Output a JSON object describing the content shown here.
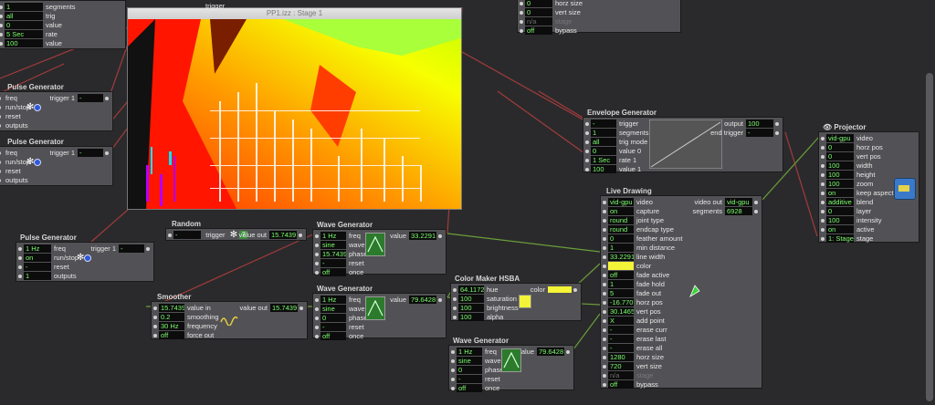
{
  "stage": {
    "title": "PP1.izz : Stage 1"
  },
  "top_left": {
    "rows": [
      {
        "value": "1",
        "label": "segments"
      },
      {
        "value": "all",
        "label": "trig"
      },
      {
        "value": "0",
        "label": "value"
      },
      {
        "value": "5 Sec",
        "label": "rate"
      },
      {
        "value": "100",
        "label": "value"
      }
    ]
  },
  "top_right": {
    "rows": [
      {
        "value": "0",
        "label": "horz size"
      },
      {
        "value": "0",
        "label": "vert size"
      },
      {
        "value": "n/a",
        "label": "stage"
      },
      {
        "value": "off",
        "label": "bypass"
      }
    ],
    "trigger_label": "trigger"
  },
  "gen_a": {
    "title": "Pulse Generator",
    "rows": [
      {
        "label": "freq"
      },
      {
        "label": "run/stop"
      },
      {
        "label": "reset"
      },
      {
        "label": "outputs"
      }
    ],
    "trigger_label": "trigger 1",
    "trigger_val": "-"
  },
  "gen_b": {
    "title": "Pulse Generator",
    "rows": [
      {
        "label": "freq"
      },
      {
        "label": "run/stop"
      },
      {
        "label": "reset"
      },
      {
        "label": "outputs"
      }
    ],
    "trigger_label": "trigger 1",
    "trigger_val": "-"
  },
  "pulse": {
    "title": "Pulse Generator",
    "rows": [
      {
        "value": "1 Hz",
        "label": "freq"
      },
      {
        "value": "on",
        "label": "run/stop"
      },
      {
        "value": "-",
        "label": "reset"
      },
      {
        "value": "1",
        "label": "outputs"
      }
    ],
    "trigger_label": "trigger 1",
    "trigger_val": "-"
  },
  "random": {
    "title": "Random",
    "in_val": "-",
    "trigger_label": "trigger",
    "value_out_label": "value out",
    "value_out": "15.7439"
  },
  "smoother": {
    "title": "Smoother",
    "rows": [
      {
        "value": "15.7439",
        "label": "value in"
      },
      {
        "value": "0.2",
        "label": "smoothing"
      },
      {
        "value": "30 Hz",
        "label": "frequency"
      },
      {
        "value": "off",
        "label": "force out"
      }
    ],
    "out_label": "value out",
    "out_val": "15.7439"
  },
  "wave1": {
    "title": "Wave Generator",
    "rows": [
      {
        "value": "1 Hz",
        "label": "freq"
      },
      {
        "value": "sine",
        "label": "wave"
      },
      {
        "value": "15.7439",
        "label": "phase"
      },
      {
        "value": "-",
        "label": "reset"
      },
      {
        "value": "off",
        "label": "once"
      }
    ],
    "out_label": "value",
    "out_val": "33.2291"
  },
  "wave2": {
    "title": "Wave Generator",
    "rows": [
      {
        "value": "1 Hz",
        "label": "freq"
      },
      {
        "value": "sine",
        "label": "wave"
      },
      {
        "value": "0",
        "label": "phase"
      },
      {
        "value": "-",
        "label": "reset"
      },
      {
        "value": "off",
        "label": "once"
      }
    ],
    "out_label": "value",
    "out_val": "79.6428"
  },
  "wave3": {
    "title": "Wave Generator",
    "rows": [
      {
        "value": "1 Hz",
        "label": "freq"
      },
      {
        "value": "sine",
        "label": "wave"
      },
      {
        "value": "0",
        "label": "phase"
      },
      {
        "value": "-",
        "label": "reset"
      },
      {
        "value": "off",
        "label": "once"
      }
    ],
    "out_label": "value",
    "out_val": "79.6428"
  },
  "color_maker": {
    "title": "Color Maker HSBA",
    "rows": [
      {
        "value": "64.1172",
        "label": "hue"
      },
      {
        "value": "100",
        "label": "saturation"
      },
      {
        "value": "100",
        "label": "brightness"
      },
      {
        "value": "100",
        "label": "alpha"
      }
    ],
    "out_label": "color"
  },
  "envelope": {
    "title": "Envelope Generator",
    "rows": [
      {
        "value": "-",
        "label": "trigger"
      },
      {
        "value": "1",
        "label": "segments"
      },
      {
        "value": "all",
        "label": "trig mode"
      },
      {
        "value": "0",
        "label": "value 0"
      },
      {
        "value": "1 Sec",
        "label": "rate 1"
      },
      {
        "value": "100",
        "label": "value 1"
      }
    ],
    "out_label": "output",
    "out_val": "100",
    "end_label": "end trigger",
    "end_val": "-"
  },
  "live": {
    "title": "Live Drawing",
    "rows": [
      {
        "value": "vid-gpu",
        "label": "video"
      },
      {
        "value": "on",
        "label": "capture"
      },
      {
        "value": "round",
        "label": "joint type"
      },
      {
        "value": "round",
        "label": "endcap type"
      },
      {
        "value": "0",
        "label": "feather amount"
      },
      {
        "value": "1",
        "label": "min distance"
      },
      {
        "value": "33.2291",
        "label": "line width"
      },
      {
        "value": "",
        "label": "color"
      },
      {
        "value": "off",
        "label": "fade active"
      },
      {
        "value": "1",
        "label": "fade hold"
      },
      {
        "value": "5",
        "label": "fade out"
      },
      {
        "value": "-16.770",
        "label": "horz pos"
      },
      {
        "value": "30.1465",
        "label": "vert pos"
      },
      {
        "value": "X",
        "label": "add point"
      },
      {
        "value": "-",
        "label": "erase curr"
      },
      {
        "value": "-",
        "label": "erase last"
      },
      {
        "value": "-",
        "label": "erase all"
      },
      {
        "value": "1280",
        "label": "horz size"
      },
      {
        "value": "720",
        "label": "vert size"
      },
      {
        "value": "n/a",
        "label": "stage"
      },
      {
        "value": "off",
        "label": "bypass"
      }
    ],
    "video_out_label": "video out",
    "video_out": "vid-gpu",
    "segments_label": "segments",
    "segments": "6928"
  },
  "projector": {
    "title": "Projector",
    "rows": [
      {
        "value": "vid-gpu",
        "label": "video"
      },
      {
        "value": "0",
        "label": "horz pos"
      },
      {
        "value": "0",
        "label": "vert pos"
      },
      {
        "value": "100",
        "label": "width"
      },
      {
        "value": "100",
        "label": "height"
      },
      {
        "value": "100",
        "label": "zoom"
      },
      {
        "value": "on",
        "label": "keep aspect"
      },
      {
        "value": "additive",
        "label": "blend"
      },
      {
        "value": "0",
        "label": "layer"
      },
      {
        "value": "100",
        "label": "intensity"
      },
      {
        "value": "on",
        "label": "active"
      },
      {
        "value": "1: Stage",
        "label": "stage"
      }
    ]
  }
}
